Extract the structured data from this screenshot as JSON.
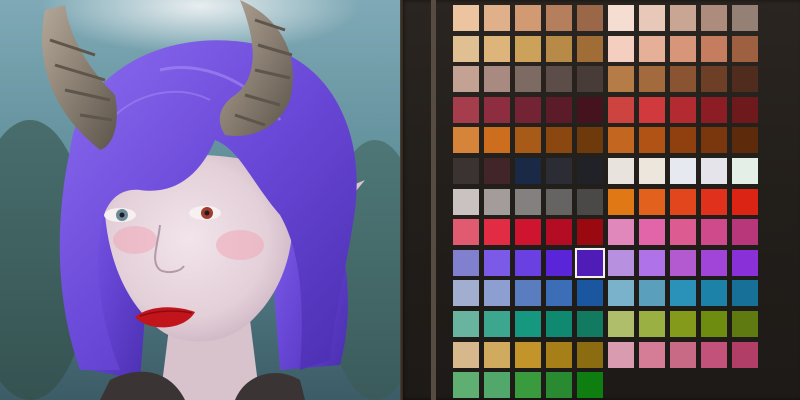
{
  "preview": {
    "colors": {
      "hair": "#6f52dc",
      "skin": "#e7d8e0",
      "horn": "#8f8478",
      "lips": "#c2141b",
      "eye_left": "#6d8a9a",
      "eye_right": "#a23b2e"
    }
  },
  "palette": {
    "selected_index": 84,
    "colors": [
      "#edc4a0",
      "#e0b08a",
      "#d19a73",
      "#b57f5e",
      "#9a6748",
      "#f5ddd2",
      "#e8c8b9",
      "#c9a594",
      "#ad8c7e",
      "#958076",
      "#e0c093",
      "#ddb479",
      "#cca15a",
      "#b88a48",
      "#a06d37",
      "#f4cfc0",
      "#e6af98",
      "#d7967a",
      "#c47e5f",
      "#9d6141",
      "#c3a294",
      "#a88a80",
      "#7d6a63",
      "#5d4d48",
      "#483c38",
      "#b67c47",
      "#a26a3d",
      "#8a5432",
      "#6d3f27",
      "#4f2c1d",
      "#a53d4d",
      "#8e2c40",
      "#742335",
      "#5b1b29",
      "#44131d",
      "#cc4340",
      "#d13a3d",
      "#b32a30",
      "#8d1d25",
      "#6e1a1d",
      "#d6843a",
      "#cc6e1e",
      "#a85a18",
      "#8b4710",
      "#6e3a0c",
      "#c36620",
      "#b15314",
      "#8f400e",
      "#7a370e",
      "#5d2a0c",
      "#3b3332",
      "#412529",
      "#1a2a46",
      "#2b2c34",
      "#202228",
      "#e8e3dd",
      "#ece6dc",
      "#e6eaf0",
      "#e4e4ea",
      "#e4efe8",
      "#cac2c0",
      "#a49c9b",
      "#84807f",
      "#666363",
      "#4b4848",
      "#e07915",
      "#e2611c",
      "#e1461c",
      "#e0311c",
      "#dc2414",
      "#e05a70",
      "#e22c44",
      "#cf1430",
      "#b40c22",
      "#9a0810",
      "#e088bb",
      "#e165a8",
      "#dc5c92",
      "#cf4a8b",
      "#b8367a",
      "#8080cf",
      "#7a5ae6",
      "#6a40e2",
      "#5a24d8",
      "#4f1cb8",
      "#b890e0",
      "#b072e8",
      "#b35ad0",
      "#a045d8",
      "#8a30d8",
      "#a2aed0",
      "#8d9fd0",
      "#5a7dc0",
      "#3c6eb8",
      "#1b56a0",
      "#7ab2cc",
      "#5aa0bd",
      "#2a92b8",
      "#1d82a8",
      "#177098",
      "#69b49e",
      "#3ca78e",
      "#169880",
      "#0f8a70",
      "#117a60",
      "#afbe6a",
      "#9bb042",
      "#839a1a",
      "#6e8d10",
      "#5e7a10",
      "#d7b88c",
      "#d0aa5e",
      "#c2942a",
      "#a67f18",
      "#8c6c10",
      "#d89bb0",
      "#d57c96",
      "#c86a86",
      "#c2527a",
      "#b03e66",
      "#5fae72",
      "#52a86a",
      "#3a9a3e",
      "#2a8a32",
      "#0e7e10"
    ]
  }
}
